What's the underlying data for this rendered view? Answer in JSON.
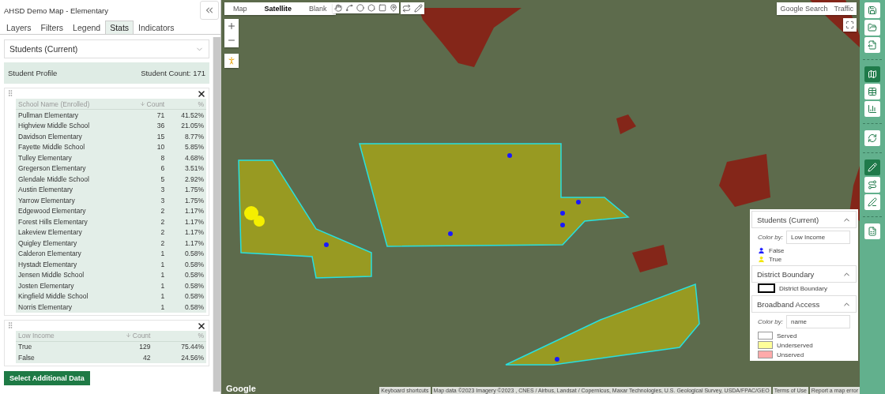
{
  "sidebar": {
    "title": "AHSD Demo Map - Elementary",
    "tabs": [
      {
        "label": "Layers",
        "selected": false
      },
      {
        "label": "Filters",
        "selected": false
      },
      {
        "label": "Legend",
        "selected": false
      },
      {
        "label": "Stats",
        "selected": true
      },
      {
        "label": "Indicators",
        "selected": false
      }
    ],
    "dataset_select": {
      "value": "Students (Current)"
    },
    "profile": {
      "label": "Student Profile",
      "count": "Student Count: 171"
    },
    "tables": [
      {
        "columns": [
          "School Name (Enrolled)",
          "Count",
          "%"
        ],
        "rows": [
          [
            "Pullman Elementary",
            "71",
            "41.52%"
          ],
          [
            "Highview Middle School",
            "36",
            "21.05%"
          ],
          [
            "Davidson Elementary",
            "15",
            "8.77%"
          ],
          [
            "Fayette Middle School",
            "10",
            "5.85%"
          ],
          [
            "Tulley Elementary",
            "8",
            "4.68%"
          ],
          [
            "Gregerson Elementary",
            "6",
            "3.51%"
          ],
          [
            "Glendale Middle School",
            "5",
            "2.92%"
          ],
          [
            "Austin Elementary",
            "3",
            "1.75%"
          ],
          [
            "Yarrow Elementary",
            "3",
            "1.75%"
          ],
          [
            "Edgewood Elementary",
            "2",
            "1.17%"
          ],
          [
            "Forest Hills Elementary",
            "2",
            "1.17%"
          ],
          [
            "Lakeview Elementary",
            "2",
            "1.17%"
          ],
          [
            "Quigley Elementary",
            "2",
            "1.17%"
          ],
          [
            "Calderon Elementary",
            "1",
            "0.58%"
          ],
          [
            "Hystadt Elementary",
            "1",
            "0.58%"
          ],
          [
            "Jensen Middle School",
            "1",
            "0.58%"
          ],
          [
            "Josten Elementary",
            "1",
            "0.58%"
          ],
          [
            "Kingfield Middle School",
            "1",
            "0.58%"
          ],
          [
            "Norris Elementary",
            "1",
            "0.58%"
          ]
        ]
      },
      {
        "columns": [
          "Low Income",
          "Count",
          "%"
        ],
        "rows": [
          [
            "True",
            "129",
            "75.44%"
          ],
          [
            "False",
            "42",
            "24.56%"
          ]
        ]
      }
    ],
    "button": "Select Additional Data"
  },
  "map": {
    "map_types": [
      {
        "label": "Map",
        "selected": false
      },
      {
        "label": "Satellite",
        "selected": true
      },
      {
        "label": "Blank",
        "selected": false
      }
    ],
    "top_buttons": [
      "Google Search",
      "Traffic"
    ],
    "logo": "Google",
    "attribution": [
      "Keyboard shortcuts",
      "Map data ©2023 Imagery ©2023 , CNES / Airbus, Landsat / Copernicus, Maxar Technologies, U.S. Geological Survey, USDA/FPAC/GEO",
      "Terms of Use",
      "Report a map error"
    ]
  },
  "legend": [
    {
      "title": "Students (Current)",
      "expanded": true,
      "color_by_label": "Color by:",
      "color_by": "Low Income",
      "items": [
        {
          "kind": "marker",
          "label": "False",
          "color": "#1a1aff"
        },
        {
          "kind": "marker",
          "label": "True",
          "color": "#f2e600"
        }
      ]
    },
    {
      "title": "District Boundary",
      "expanded": true,
      "items": [
        {
          "kind": "outline",
          "label": "District Boundary",
          "color": "#000000"
        }
      ]
    },
    {
      "title": "Broadband Access",
      "expanded": true,
      "color_by_label": "Color by:",
      "color_by": "name",
      "items": [
        {
          "kind": "swatch",
          "label": "Served",
          "color": "#ffffff"
        },
        {
          "kind": "swatch",
          "label": "Underserved",
          "color": "#ffff99"
        },
        {
          "kind": "swatch",
          "label": "Unserved",
          "color": "#ffaaaa"
        }
      ]
    }
  ],
  "toolbar": [
    [
      {
        "selected": false
      },
      {
        "selected": false
      },
      {
        "selected": false
      }
    ],
    [
      {
        "selected": true
      },
      {
        "selected": false
      },
      {
        "selected": false
      }
    ],
    [
      {
        "selected": false
      }
    ],
    [
      {
        "selected": true
      },
      {
        "selected": false
      },
      {
        "selected": false
      }
    ],
    [
      {
        "selected": false
      }
    ]
  ]
}
